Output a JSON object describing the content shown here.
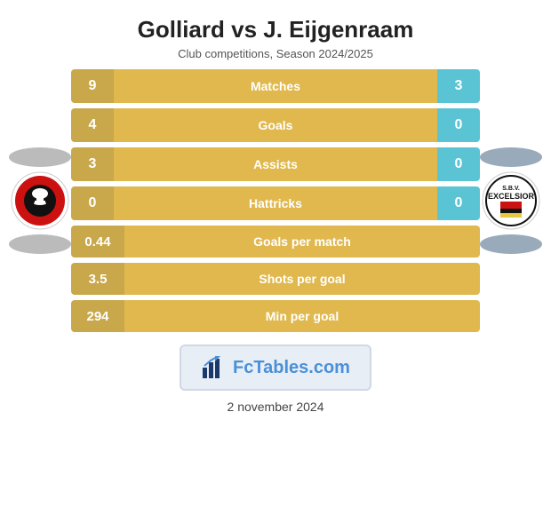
{
  "header": {
    "title": "Golliard vs J. Eijgenraam",
    "subtitle": "Club competitions, Season 2024/2025"
  },
  "stats": {
    "matches": {
      "label": "Matches",
      "left": "9",
      "right": "3"
    },
    "goals": {
      "label": "Goals",
      "left": "4",
      "right": "0"
    },
    "assists": {
      "label": "Assists",
      "left": "3",
      "right": "0"
    },
    "hattricks": {
      "label": "Hattricks",
      "left": "0",
      "right": "0"
    },
    "goals_per_match": {
      "label": "Goals per match",
      "value": "0.44"
    },
    "shots_per_goal": {
      "label": "Shots per goal",
      "value": "3.5"
    },
    "min_per_goal": {
      "label": "Min per goal",
      "value": "294"
    }
  },
  "fctables": {
    "text": "FcTables.com",
    "fc_part": "Fc",
    "tables_part": "Tables.com"
  },
  "footer": {
    "date": "2 november 2024"
  }
}
